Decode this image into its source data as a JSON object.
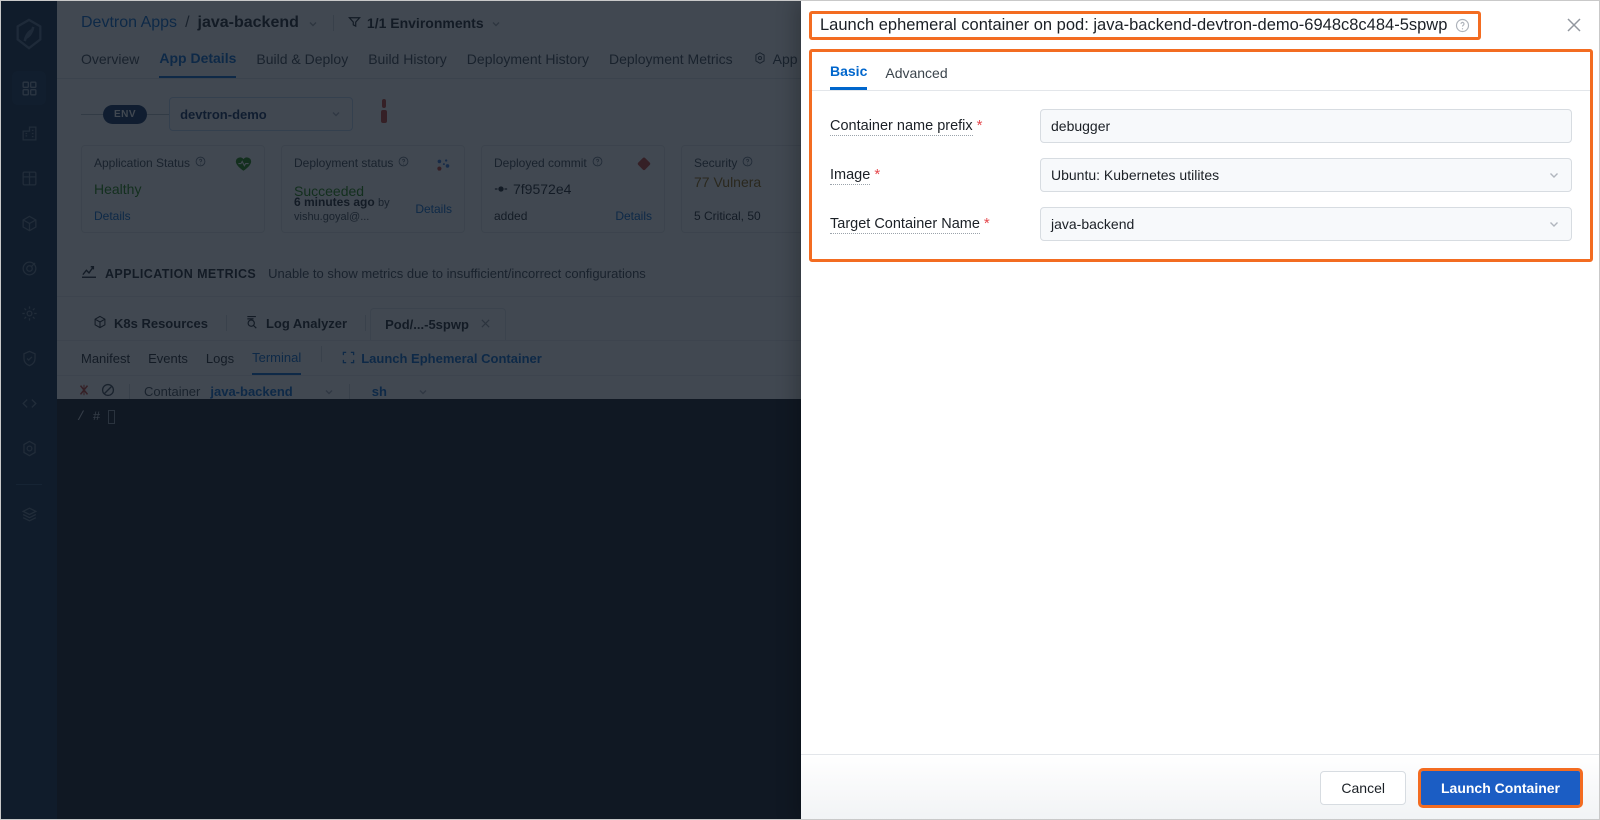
{
  "background_app": {
    "rail": {
      "logo_icon": "devtron-logo-icon",
      "items": [
        {
          "icon": "apps-grid-icon",
          "active": true
        },
        {
          "icon": "chart-bar-icon",
          "active": false
        },
        {
          "icon": "table-grid-icon",
          "active": false
        },
        {
          "icon": "cube-icon",
          "active": false
        },
        {
          "icon": "target-icon",
          "active": false
        },
        {
          "icon": "gear-icon",
          "active": false
        },
        {
          "icon": "shield-icon",
          "active": false
        },
        {
          "icon": "code-icon",
          "active": false
        },
        {
          "icon": "hexagon-gear-icon",
          "active": false
        },
        {
          "icon": "stack-layers-icon",
          "active": false
        }
      ]
    },
    "breadcrumb": {
      "root": "Devtron Apps",
      "separator": "/",
      "current": "java-backend",
      "environments": "1/1 Environments"
    },
    "nav_tabs": [
      {
        "label": "Overview",
        "selected": false
      },
      {
        "label": "App Details",
        "selected": true
      },
      {
        "label": "Build & Deploy",
        "selected": false
      },
      {
        "label": "Build History",
        "selected": false
      },
      {
        "label": "Deployment History",
        "selected": false
      },
      {
        "label": "Deployment Metrics",
        "selected": false
      },
      {
        "label": "App Configuration",
        "selected": false,
        "icon": "gear-icon"
      }
    ],
    "env_row": {
      "pill": "ENV",
      "selected_env": "devtron-demo",
      "chevron_icon": "chevron-down-icon",
      "pin_icon": "pin-marker-icon"
    },
    "cards": [
      {
        "title": "Application Status",
        "value": "Healthy",
        "value_color": "green",
        "icon": "heart-health-icon",
        "footer_left": "",
        "footer_right": "Details"
      },
      {
        "title": "Deployment status",
        "value": "Succeeded",
        "value_color": "green",
        "icon": "deployment-spinner-icon",
        "footer_left": "6 minutes ago",
        "footer_muted": "by vishu.goyal@...",
        "footer_right": "Details"
      },
      {
        "title": "Deployed commit",
        "value": "7f9572e4",
        "value_color": "dark",
        "icon": "git-diamond-icon",
        "footer_left": "added",
        "footer_right": "Details"
      },
      {
        "title": "Security",
        "value": "77 Vulnera",
        "value_color": "orange",
        "icon": "",
        "footer_left": "5 Critical, 50",
        "footer_right": ""
      }
    ],
    "metrics": {
      "icon": "metrics-chart-icon",
      "title": "APPLICATION METRICS",
      "subtitle": "Unable to show metrics due to insufficient/incorrect configurations"
    },
    "resource_tabs": [
      {
        "label": "K8s Resources",
        "icon": "cube-icon",
        "boxed": false,
        "closable": false
      },
      {
        "label": "Log Analyzer",
        "icon": "log-search-icon",
        "boxed": false,
        "closable": false
      },
      {
        "label": "Pod/...-5spwp",
        "icon": "",
        "boxed": true,
        "closable": true
      }
    ],
    "sub_tabs": [
      {
        "label": "Manifest",
        "selected": false
      },
      {
        "label": "Events",
        "selected": false
      },
      {
        "label": "Logs",
        "selected": false
      },
      {
        "label": "Terminal",
        "selected": true
      }
    ],
    "launch_ephemeral_link": {
      "label": "Launch Ephemeral Container",
      "icon": "expand-brackets-icon"
    },
    "terminal_bar": {
      "abort_icon": "terminal-disconnect-icon",
      "clear_icon": "no-entry-icon",
      "container_label": "Container",
      "container_value": "java-backend",
      "shell_value": "sh",
      "chevron_icon": "chevron-down-icon"
    },
    "terminal": {
      "prompt": "/ #"
    }
  },
  "modal": {
    "title": "Launch ephemeral container on pod: java-backend-devtron-demo-6948c8c484-5spwp",
    "help_icon": "help-circle-icon",
    "close_icon": "close-icon",
    "tabs": [
      {
        "label": "Basic",
        "selected": true
      },
      {
        "label": "Advanced",
        "selected": false
      }
    ],
    "fields": [
      {
        "label": "Container name prefix",
        "required_marker": "*",
        "value": "debugger",
        "type": "text",
        "has_chevron": false
      },
      {
        "label": "Image",
        "required_marker": "*",
        "value": "Ubuntu: Kubernetes utilites",
        "type": "select",
        "has_chevron": true
      },
      {
        "label": "Target Container Name",
        "required_marker": "*",
        "value": "java-backend",
        "type": "select",
        "has_chevron": true
      }
    ],
    "footer": {
      "cancel_label": "Cancel",
      "submit_label": "Launch Container"
    }
  },
  "highlights": {
    "color": "#f36c21",
    "regions": [
      "modal-title",
      "modal-form-panel",
      "launch-container-button"
    ]
  },
  "colors": {
    "accent_blue": "#0066cc",
    "primary_button": "#1b5dc4",
    "highlight_orange": "#f36c21",
    "rail_navy": "#0b2441",
    "terminal_bg": "#0b0f19",
    "success_green": "#1d8102",
    "required_red": "#e5484d",
    "warning_orange": "#8c6100"
  }
}
